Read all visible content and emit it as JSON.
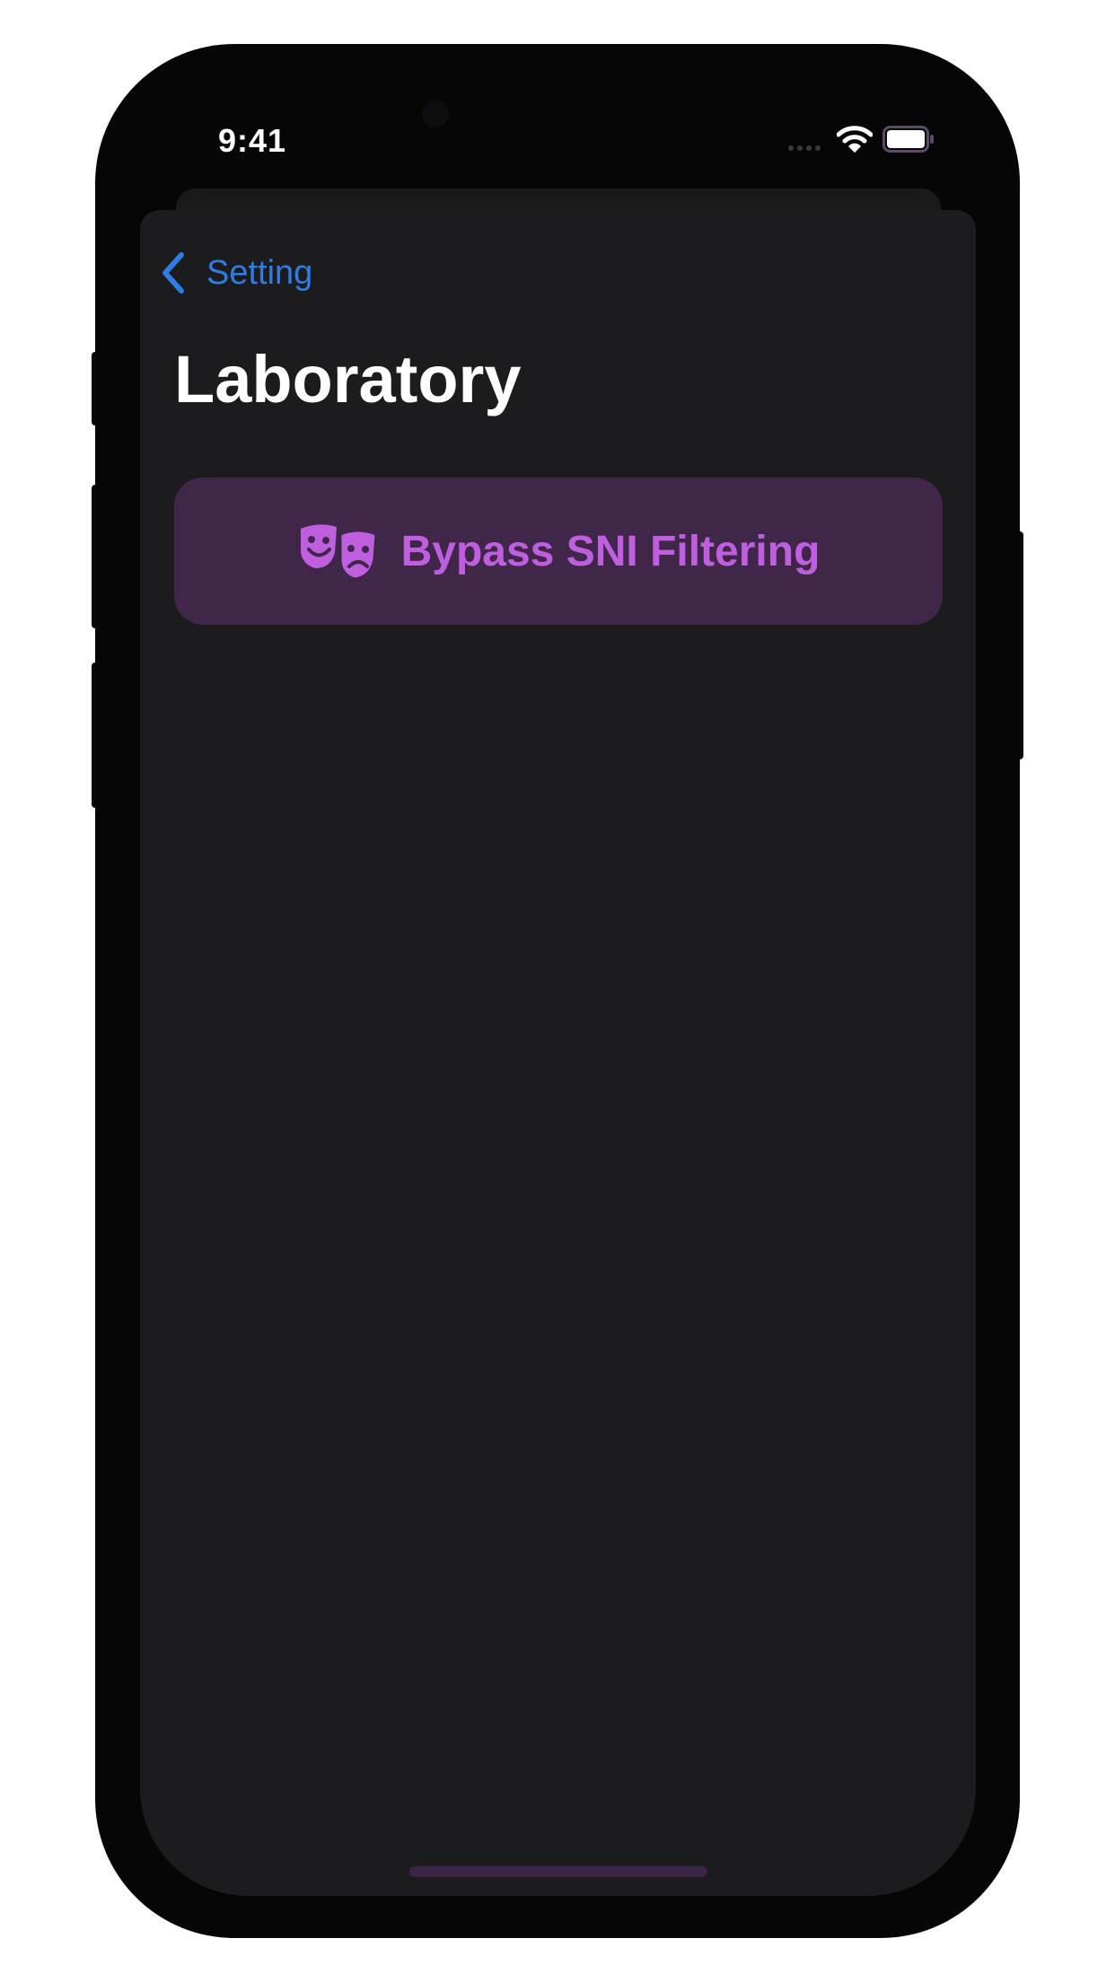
{
  "status_bar": {
    "time": "9:41"
  },
  "nav": {
    "back_label": "Setting"
  },
  "page": {
    "title": "Laboratory"
  },
  "actions": [
    {
      "label": "Bypass SNI Filtering",
      "icon": "theater-masks-icon"
    }
  ],
  "colors": {
    "accent_blue": "#2f7de1",
    "action_text": "#bf5fe0",
    "action_background": "#40274a",
    "sheet_background": "#1c1c1e"
  }
}
